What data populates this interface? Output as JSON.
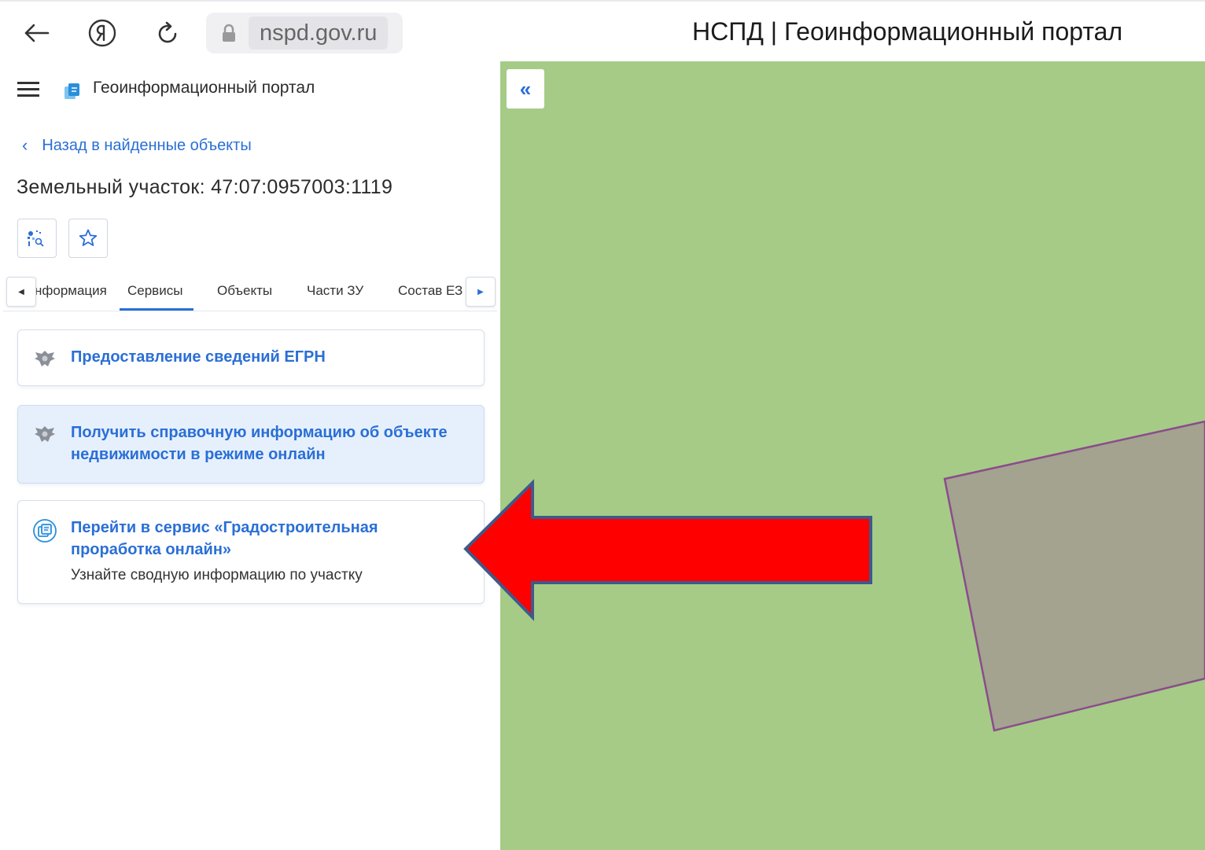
{
  "browser": {
    "url": "nspd.gov.ru",
    "page_title": "НСПД | Геоинформационный портал"
  },
  "header": {
    "portal_name": "Геоинформационный портал"
  },
  "back_link": "Назад в найденные объекты",
  "object_title": "Земельный участок: 47:07:0957003:1119",
  "tabs": [
    {
      "label": "нформация"
    },
    {
      "label": "Сервисы",
      "active": true
    },
    {
      "label": "Объекты"
    },
    {
      "label": "Части ЗУ"
    },
    {
      "label": "Состав ЕЗ"
    }
  ],
  "services": [
    {
      "title": "Предоставление сведений ЕГРН"
    },
    {
      "title": "Получить справочную информацию об объекте недвижимости в режиме онлайн"
    },
    {
      "title": "Перейти в сервис «Градостроительная проработка онлайн»",
      "subtitle": "Узнайте сводную информацию по участку"
    }
  ],
  "map": {
    "collapse_label": "«",
    "background_color": "#a6cb87",
    "parcel_fill": "#a3a38f",
    "parcel_stroke": "#8b4c8c"
  },
  "annotation": {
    "arrow_color": "#ff0000",
    "arrow_stroke": "#3d5a8a"
  }
}
